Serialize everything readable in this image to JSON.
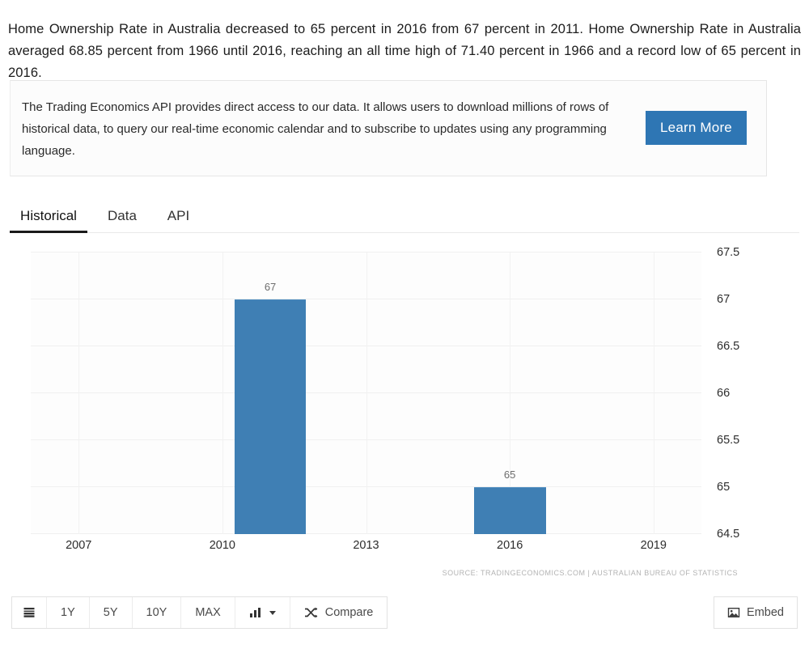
{
  "intro": {
    "text": "Home Ownership Rate in Australia decreased to 65 percent in 2016 from 67 percent in 2011. Home Ownership Rate in Australia averaged 68.85 percent from 1966 until 2016, reaching an all time high of 71.40 percent in 1966 and a record low of 65 percent in 2016."
  },
  "api_promo": {
    "text": "The Trading Economics API provides direct access to our data. It allows users to download millions of rows of historical data, to query our real-time economic calendar and to subscribe to updates using any programming language.",
    "button_label": "Learn More",
    "button_color": "#2e76b4"
  },
  "tabs": [
    {
      "label": "Historical",
      "active": true
    },
    {
      "label": "Data",
      "active": false
    },
    {
      "label": "API",
      "active": false
    }
  ],
  "chart_data": {
    "type": "bar",
    "title": "",
    "xlabel": "",
    "ylabel": "",
    "categories": [
      "2011",
      "2016"
    ],
    "values": [
      67,
      65
    ],
    "data_labels": [
      "67",
      "65"
    ],
    "x_positions": [
      2011,
      2016
    ],
    "xlim": [
      2006,
      2020
    ],
    "ylim": [
      64.5,
      67.5
    ],
    "x_tick_labels": [
      "2007",
      "2010",
      "2013",
      "2016",
      "2019"
    ],
    "x_tick_values": [
      2007,
      2010,
      2013,
      2016,
      2019
    ],
    "y_tick_labels": [
      "67.5",
      "67",
      "66.5",
      "66",
      "65.5",
      "65",
      "64.5"
    ],
    "y_tick_values": [
      67.5,
      67,
      66.5,
      66,
      65.5,
      65,
      64.5
    ],
    "grid": true,
    "legend": "none",
    "y_axis_position": "right",
    "bar_color": "#3f7fb4"
  },
  "source_note": "SOURCE: TRADINGECONOMICS.COM | AUSTRALIAN BUREAU OF STATISTICS",
  "toolbar": {
    "range_buttons": [
      "1Y",
      "5Y",
      "10Y",
      "MAX"
    ],
    "compare_label": "Compare",
    "embed_label": "Embed"
  }
}
